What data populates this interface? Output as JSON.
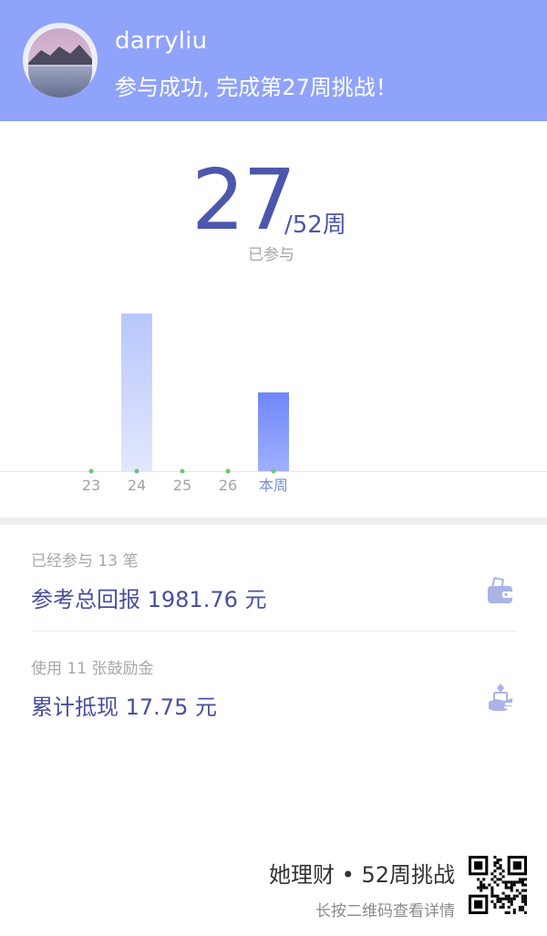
{
  "header": {
    "username": "darryliu",
    "message": "参与成功, 完成第27周挑战！"
  },
  "progress": {
    "count": "27",
    "total": "/52周",
    "label": "已参与"
  },
  "chart_data": {
    "type": "bar",
    "categories": [
      "23",
      "24",
      "25",
      "26",
      "本周"
    ],
    "values": [
      0,
      1.0,
      0,
      0,
      0.5
    ],
    "highlight_category": "本周",
    "colors": {
      "bar": "#b9c6fb",
      "current_bar": "#6f86fb",
      "dot": "#6cc47a",
      "axis": "#e6e6e6",
      "current_label": "#7b8fd9"
    }
  },
  "stats": {
    "participated": "已经参与 13 笔",
    "total_return": "参考总回报 1981.76 元",
    "vouchers_used": "使用 11 张鼓励金",
    "cash_back": "累计抵现 17.75 元"
  },
  "icons": {
    "wallet": "wallet-icon",
    "cash": "cash-hand-icon",
    "qr": "qr-code-icon"
  },
  "footer": {
    "brand": "她理财 • 52周挑战",
    "hint": "长按二维码查看详情"
  },
  "colors": {
    "header_bg": "#8fa3fb",
    "accent": "#4c56ad",
    "icon": "#aab3e6"
  }
}
